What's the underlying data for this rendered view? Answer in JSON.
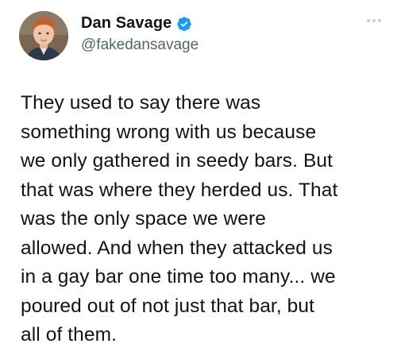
{
  "tweet": {
    "author": {
      "display_name": "Dan Savage",
      "handle": "@fakedansavage",
      "verified": true,
      "avatar_icon": "profile-photo"
    },
    "more_icon": "more-horizontal-icon",
    "text_lines": [
      "They used to say there was",
      "something wrong with us because",
      "we only gathered in seedy bars. But",
      "that was where they herded us. That",
      "was the only space we were",
      "allowed. And when they attacked us",
      "in a gay bar one time too many... we",
      "poured out of not just that bar, but",
      "all of them."
    ]
  },
  "colors": {
    "text": "#0f1419",
    "secondary_text": "#536471",
    "verified_badge": "#1d9bf0",
    "more_dots": "#c4cfd6"
  }
}
